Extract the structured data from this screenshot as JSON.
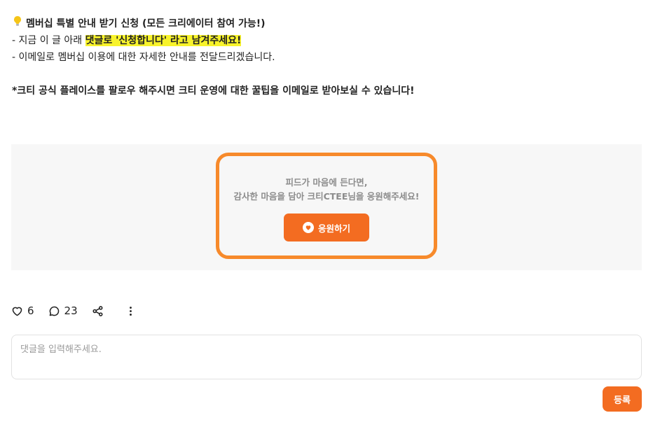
{
  "post": {
    "title_icon": "lightbulb-icon",
    "title": "멤버십 특별 안내 받기 신청 (모든 크리에이터 참여 가능!)",
    "line1_prefix": "- 지금 이 글 아래 ",
    "line1_highlight": "댓글로 '신청합니다' 라고 남겨주세요!",
    "line2": "- 이메일로 멤버십 이용에 대한 자세한 안내를 전달드리겠습니다.",
    "line3": "*크티 공식 플레이스를 팔로우 해주시면 크티 운영에 대한 꿀팁을 이메일로 받아보실 수 있습니다!"
  },
  "support": {
    "text_line1": "피드가 마음에 든다면,",
    "text_line2": "감사한 마음을 담아 크티CTEE님을 응원해주세요!",
    "button_label": "응원하기",
    "accent_color": "#f36c21",
    "border_color": "#f78a2b"
  },
  "actions": {
    "like_count": "6",
    "comment_count": "23"
  },
  "comment": {
    "placeholder": "댓글을 입력해주세요.",
    "value": "",
    "submit_label": "등록"
  }
}
